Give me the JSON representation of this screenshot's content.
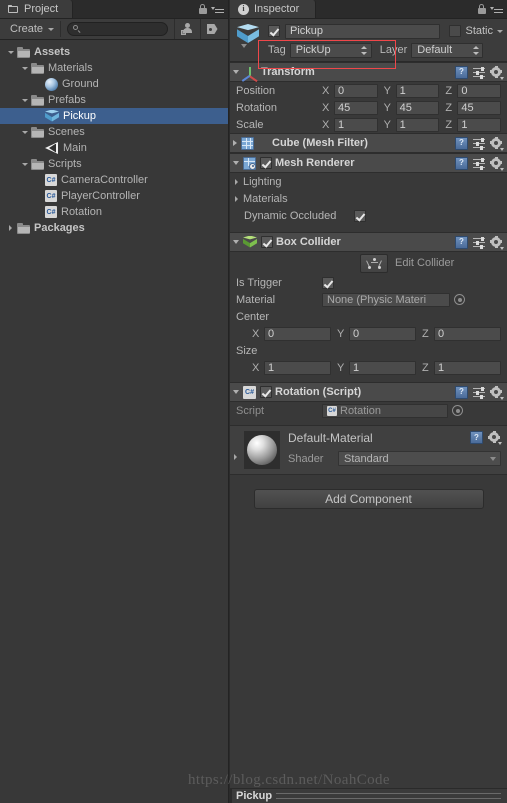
{
  "project_panel": {
    "tab_label": "Project",
    "toolbar": {
      "create_label": "Create",
      "search_placeholder": "",
      "search_value": ""
    },
    "tree": [
      {
        "label": "Assets",
        "indent": 0,
        "arrow": "down",
        "icon": "folder-icon",
        "bold": true,
        "selected": false
      },
      {
        "label": "Materials",
        "indent": 1,
        "arrow": "down",
        "icon": "folder-icon",
        "bold": false,
        "selected": false
      },
      {
        "label": "Ground",
        "indent": 2,
        "arrow": "none",
        "icon": "sphere-icon",
        "bold": false,
        "selected": false
      },
      {
        "label": "Prefabs",
        "indent": 1,
        "arrow": "down",
        "icon": "folder-icon",
        "bold": false,
        "selected": false
      },
      {
        "label": "Pickup",
        "indent": 2,
        "arrow": "none",
        "icon": "cube-icon",
        "bold": false,
        "selected": true
      },
      {
        "label": "Scenes",
        "indent": 1,
        "arrow": "down",
        "icon": "folder-icon",
        "bold": false,
        "selected": false
      },
      {
        "label": "Main",
        "indent": 2,
        "arrow": "none",
        "icon": "scene-icon",
        "bold": false,
        "selected": false
      },
      {
        "label": "Scripts",
        "indent": 1,
        "arrow": "down",
        "icon": "folder-icon",
        "bold": false,
        "selected": false
      },
      {
        "label": "CameraController",
        "indent": 2,
        "arrow": "none",
        "icon": "cs-icon",
        "bold": false,
        "selected": false
      },
      {
        "label": "PlayerController",
        "indent": 2,
        "arrow": "none",
        "icon": "cs-icon",
        "bold": false,
        "selected": false
      },
      {
        "label": "Rotation",
        "indent": 2,
        "arrow": "none",
        "icon": "cs-icon",
        "bold": false,
        "selected": false
      },
      {
        "label": "Packages",
        "indent": 0,
        "arrow": "right",
        "icon": "folder-icon",
        "bold": true,
        "selected": false
      }
    ]
  },
  "inspector": {
    "tab_label": "Inspector",
    "object": {
      "name": "Pickup",
      "enabled": true,
      "static_label": "Static",
      "static_checked": false,
      "tag_label": "Tag",
      "tag_value": "PickUp",
      "layer_label": "Layer",
      "layer_value": "Default"
    },
    "highlight_color": "#f0474a",
    "transform": {
      "title": "Transform",
      "expanded": true,
      "rows": [
        {
          "label": "Position",
          "x": "0",
          "y": "1",
          "z": "0"
        },
        {
          "label": "Rotation",
          "x": "45",
          "y": "45",
          "z": "45"
        },
        {
          "label": "Scale",
          "x": "1",
          "y": "1",
          "z": "1"
        }
      ],
      "axis_x": "X",
      "axis_y": "Y",
      "axis_z": "Z"
    },
    "mesh_filter": {
      "title": "Cube (Mesh Filter)",
      "expanded": false
    },
    "mesh_renderer": {
      "title": "Mesh Renderer",
      "enabled": true,
      "expanded": true,
      "lighting_label": "Lighting",
      "materials_label": "Materials",
      "dynamic_occluded_label": "Dynamic Occluded",
      "dynamic_occluded_checked": true
    },
    "box_collider": {
      "title": "Box Collider",
      "enabled": true,
      "expanded": true,
      "edit_collider_label": "Edit Collider",
      "is_trigger_label": "Is Trigger",
      "is_trigger_checked": true,
      "material_label": "Material",
      "material_value": "None (Physic Materi",
      "center_label": "Center",
      "center": {
        "x": "0",
        "y": "0",
        "z": "0"
      },
      "size_label": "Size",
      "size": {
        "x": "1",
        "y": "1",
        "z": "1"
      }
    },
    "rotation_script": {
      "title": "Rotation (Script)",
      "enabled": true,
      "expanded": true,
      "script_label": "Script",
      "script_value": "Rotation"
    },
    "material": {
      "title": "Default-Material",
      "shader_label": "Shader",
      "shader_value": "Standard"
    },
    "add_component_label": "Add Component"
  },
  "status_bar": {
    "label": "Pickup"
  },
  "watermark": {
    "text": "https://blog.csdn.net/NoahCode"
  }
}
